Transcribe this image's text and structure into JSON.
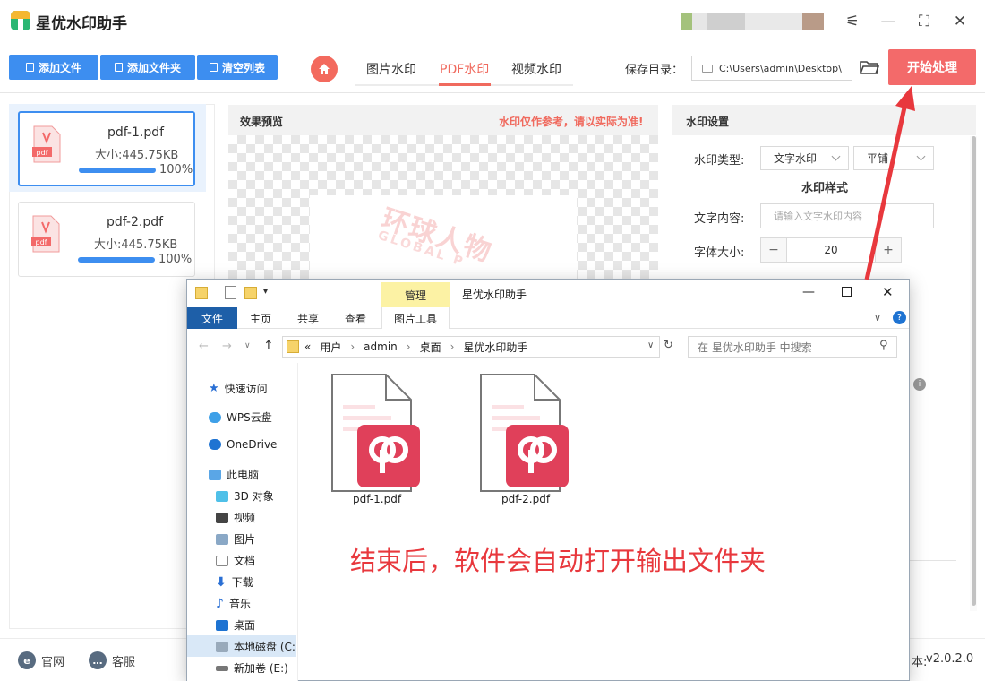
{
  "app": {
    "title": "星优水印助手",
    "version": "v2.0.2.0"
  },
  "toolbar": {
    "add_file": "添加文件",
    "add_folder": "添加文件夹",
    "clear_list": "清空列表",
    "tabs": [
      "图片水印",
      "PDF水印",
      "视频水印"
    ],
    "active_tab": "PDF水印",
    "save_label": "保存目录：",
    "save_path": "C:\\Users\\admin\\Desktop\\",
    "start": "开始处理"
  },
  "files": [
    {
      "name": "pdf-1.pdf",
      "size": "大小:445.75KB",
      "progress": "100%",
      "progress_value": 1.0
    },
    {
      "name": "pdf-2.pdf",
      "size": "大小:445.75KB",
      "progress": "100%",
      "progress_value": 1.0
    }
  ],
  "preview": {
    "title": "效果预览",
    "note": "水印仅作参考，请以实际为准!",
    "watermark": "环球人物",
    "watermark_sub": "GLOBAL P"
  },
  "settings": {
    "title": "水印设置",
    "type_label": "水印类型:",
    "type_value": "文字水印",
    "mode_value": "平铺",
    "style_title": "水印样式",
    "text_label": "文字内容:",
    "text_placeholder": "请输入文字水印内容",
    "font_size_label": "字体大小:",
    "font_size_value": "20",
    "minus": "−",
    "plus": "+"
  },
  "footer": {
    "official": "官网",
    "service": "客服",
    "version_prefix": "本:"
  },
  "explorer": {
    "title": "星优水印助手",
    "manage": "管理",
    "ribbon": [
      "文件",
      "主页",
      "共享",
      "查看",
      "图片工具"
    ],
    "path": [
      "«",
      "用户",
      "admin",
      "桌面",
      "星优水印助手"
    ],
    "search_placeholder": "在 星优水印助手 中搜索",
    "nav": [
      "快速访问",
      "WPS云盘",
      "OneDrive",
      "此电脑",
      "3D 对象",
      "视频",
      "图片",
      "文档",
      "下载",
      "音乐",
      "桌面",
      "本地磁盘 (C:",
      "新加卷 (E:)"
    ],
    "files": [
      "pdf-1.pdf",
      "pdf-2.pdf"
    ],
    "message": "结束后，软件会自动打开输出文件夹"
  },
  "colors": {
    "accent": "#3d8ef0",
    "start": "#f36a6a",
    "red_text": "#e8383d"
  }
}
